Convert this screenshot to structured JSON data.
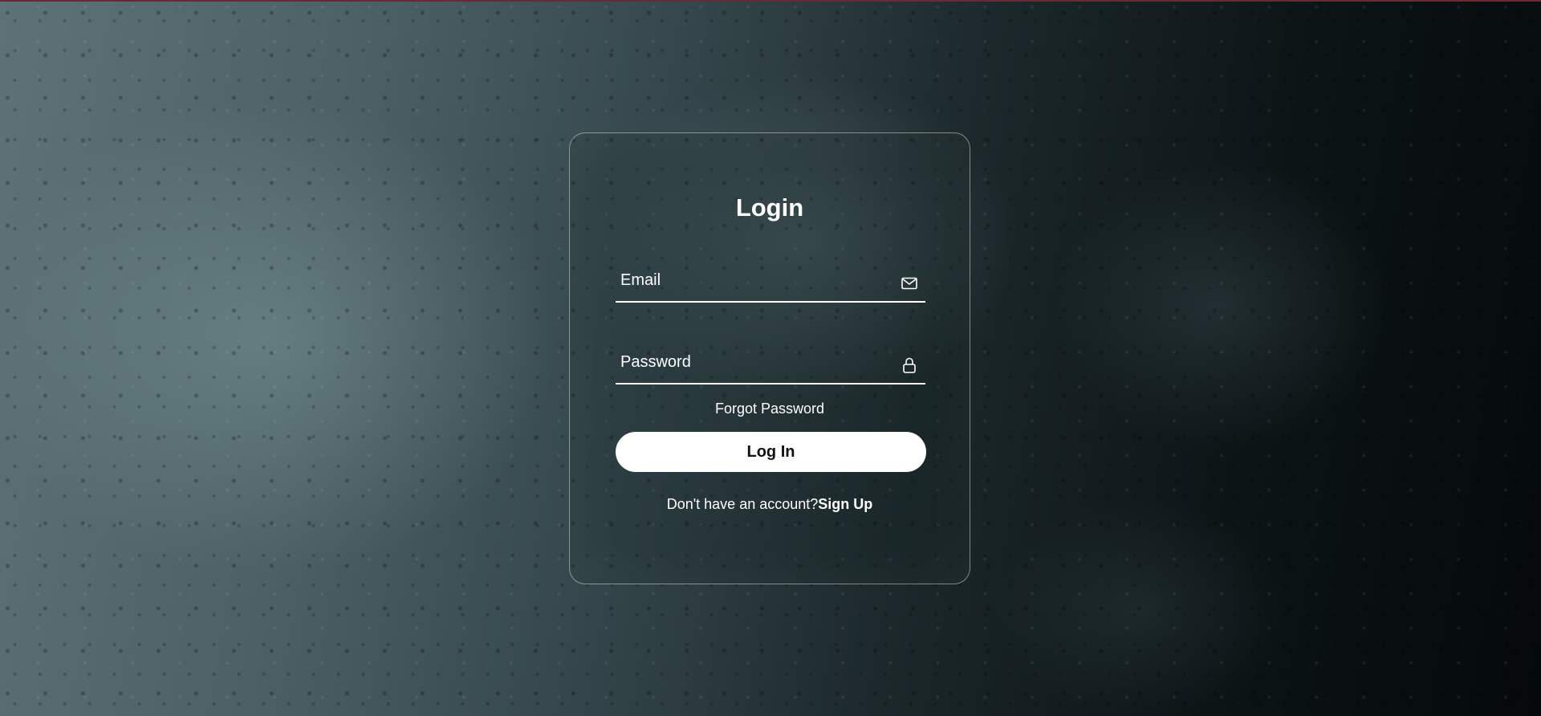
{
  "login": {
    "title": "Login",
    "email": {
      "placeholder": "Email",
      "value": "",
      "icon": "envelope-icon"
    },
    "password": {
      "placeholder": "Password",
      "value": "",
      "icon": "lock-icon"
    },
    "forgot_label": "Forgot Password",
    "button_label": "Log In",
    "signup_prompt": "Don't have an account?",
    "signup_label": "Sign Up"
  },
  "colors": {
    "text": "#ffffff",
    "button_bg": "#ffffff",
    "button_text": "#111111",
    "card_border": "rgba(255,255,255,0.45)"
  }
}
